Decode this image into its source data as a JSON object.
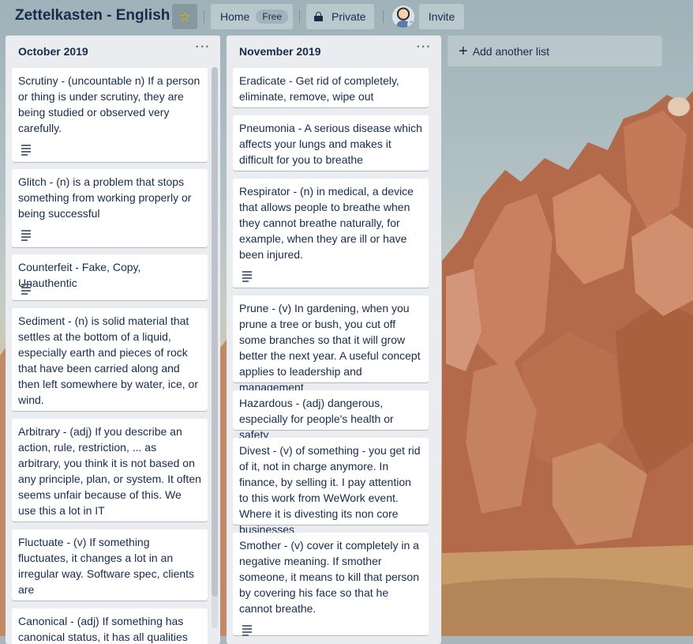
{
  "header": {
    "board_title": "Zettelkasten - English",
    "home_label": "Home",
    "free_badge": "Free",
    "private_label": "Private",
    "invite_label": "Invite",
    "star_icon": "star-icon"
  },
  "colors": {
    "list_bg": "#ebecf0",
    "card_bg": "#ffffff",
    "text": "#172b4d",
    "star": "#f2d600"
  },
  "lists": [
    {
      "title": "October 2019",
      "menu": "···",
      "cards": [
        {
          "text": "Scrutiny - (uncountable n) If a person or thing is under scrutiny, they are being studied or observed very carefully.",
          "has_description": true
        },
        {
          "text": "Glitch - (n) is a problem that stops something from working properly or being successful",
          "has_description": true
        },
        {
          "text": "Counterfeit - Fake, Copy, Unauthentic",
          "has_description": true
        },
        {
          "text": "Sediment - (n) is solid material that settles at the bottom of a liquid, especially earth and pieces of rock that have been carried along and then left somewhere by water, ice, or wind.",
          "has_description": false
        },
        {
          "text": "Arbitrary - (adj) If you describe an action, rule, restriction, ... as arbitrary, you think it is not based on any principle, plan, or system. It often seems unfair because of this. We use this a lot in IT",
          "has_description": false
        },
        {
          "text": "Fluctuate - (v) If something fluctuates, it changes a lot in an irregular way. Software spec, clients are",
          "has_description": false
        },
        {
          "text": "Canonical - (adj) If something has canonical status, it has all qualities",
          "has_description": false
        }
      ]
    },
    {
      "title": "November 2019",
      "menu": "···",
      "cards": [
        {
          "text": "Eradicate - Get rid of completely, eliminate, remove, wipe out",
          "has_description": false
        },
        {
          "text": "Pneumonia - A serious disease which affects your lungs and makes it difficult for you to breathe",
          "has_description": false
        },
        {
          "text": "Respirator - (n) in medical, a device that allows people to breathe when they cannot breathe naturally, for example, when they are ill or have been injured.",
          "has_description": true
        },
        {
          "text": "Prune - (v) In gardening, when you prune a tree or bush, you cut off some branches so that it will grow better the next year. A useful concept applies to leadership and management",
          "has_description": false
        },
        {
          "text": "Hazardous - (adj) dangerous, especially for people's health or safety",
          "has_description": false
        },
        {
          "text": "Divest - (v) of something - you get rid of it, not in charge anymore. In finance, by selling it. I pay attention to this work from WeWork event. Where it is divesting its non core businesses",
          "has_description": false
        },
        {
          "text": "Smother - (v) cover it completely in a negative meaning. If smother someone, it means to kill that person by covering his face so that he cannot breathe.",
          "has_description": true
        }
      ]
    }
  ],
  "add_list_label": "Add another list"
}
